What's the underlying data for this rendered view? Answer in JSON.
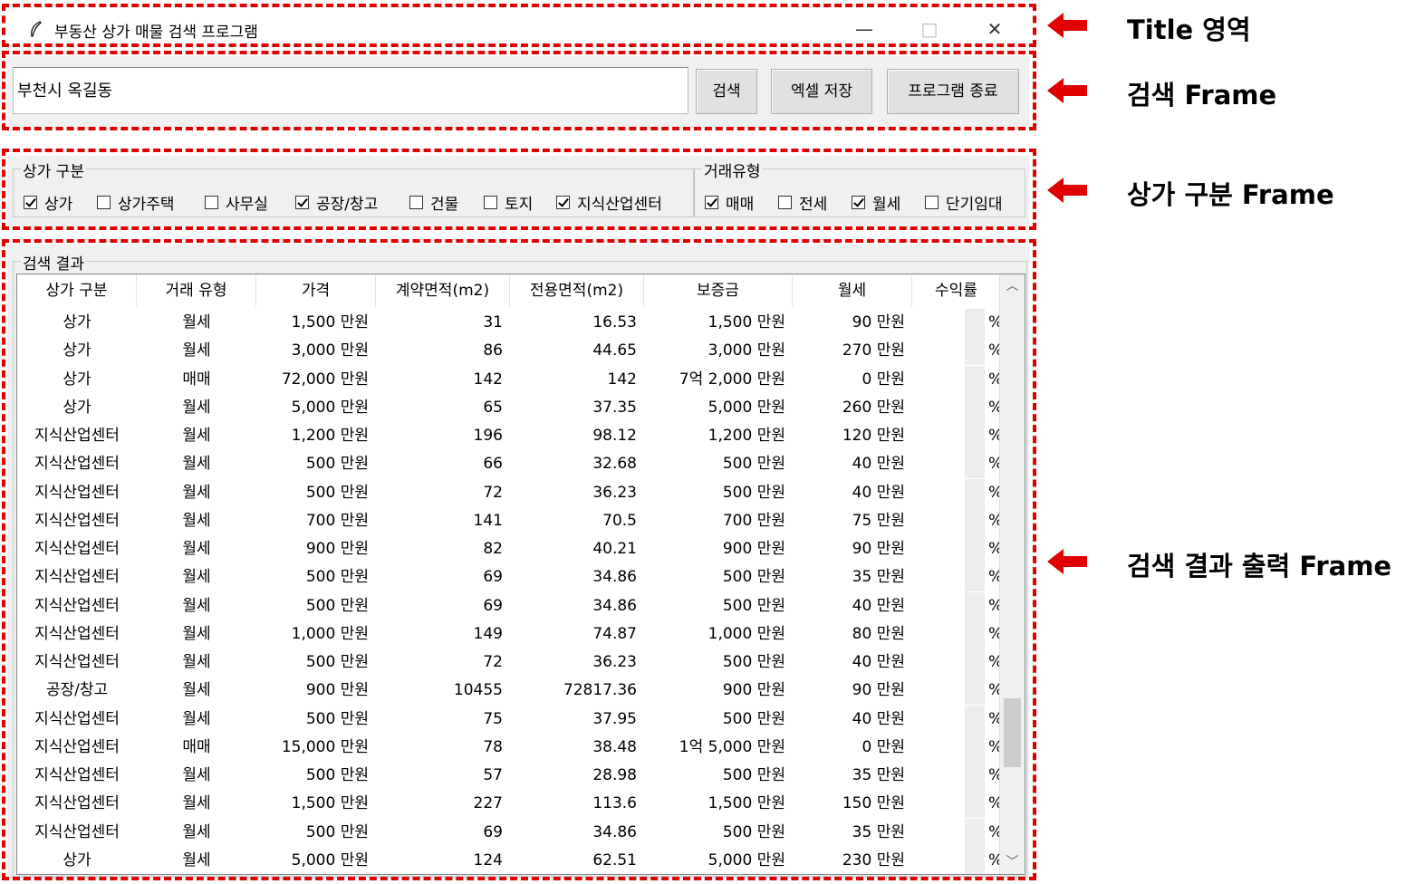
{
  "window": {
    "title": "부동산 상가 매물 검색 프로그램",
    "minimize": "—",
    "maximize": "□",
    "close": "✕"
  },
  "search": {
    "value": "부천시 옥길동",
    "search_button": "검색",
    "excel_button": "엑셀 저장",
    "exit_button": "프로그램 종료"
  },
  "store_type": {
    "label": "상가 구분",
    "options": [
      {
        "label": "상가",
        "checked": true
      },
      {
        "label": "상가주택",
        "checked": false
      },
      {
        "label": "사무실",
        "checked": false
      },
      {
        "label": "공장/창고",
        "checked": true
      },
      {
        "label": "건물",
        "checked": false
      },
      {
        "label": "토지",
        "checked": false
      },
      {
        "label": "지식산업센터",
        "checked": true
      }
    ]
  },
  "deal_type": {
    "label": "거래유형",
    "options": [
      {
        "label": "매매",
        "checked": true
      },
      {
        "label": "전세",
        "checked": false
      },
      {
        "label": "월세",
        "checked": true
      },
      {
        "label": "단기임대",
        "checked": false
      }
    ]
  },
  "results": {
    "label": "검색 결과",
    "columns": [
      "상가 구분",
      "거래 유형",
      "가격",
      "계약면적(m2)",
      "전용면적(m2)",
      "보증금",
      "월세",
      "수익률"
    ],
    "rows": [
      [
        "상가",
        "월세",
        "1,500 만원",
        "31",
        "16.53",
        "1,500 만원",
        "90 만원",
        "%"
      ],
      [
        "상가",
        "월세",
        "3,000 만원",
        "86",
        "44.65",
        "3,000 만원",
        "270 만원",
        "%"
      ],
      [
        "상가",
        "매매",
        "72,000 만원",
        "142",
        "142",
        "7억 2,000 만원",
        "0 만원",
        "%"
      ],
      [
        "상가",
        "월세",
        "5,000 만원",
        "65",
        "37.35",
        "5,000 만원",
        "260 만원",
        "%"
      ],
      [
        "지식산업센터",
        "월세",
        "1,200 만원",
        "196",
        "98.12",
        "1,200 만원",
        "120 만원",
        "%"
      ],
      [
        "지식산업센터",
        "월세",
        "500 만원",
        "66",
        "32.68",
        "500 만원",
        "40 만원",
        "%"
      ],
      [
        "지식산업센터",
        "월세",
        "500 만원",
        "72",
        "36.23",
        "500 만원",
        "40 만원",
        "%"
      ],
      [
        "지식산업센터",
        "월세",
        "700 만원",
        "141",
        "70.5",
        "700 만원",
        "75 만원",
        "%"
      ],
      [
        "지식산업센터",
        "월세",
        "900 만원",
        "82",
        "40.21",
        "900 만원",
        "90 만원",
        "%"
      ],
      [
        "지식산업센터",
        "월세",
        "500 만원",
        "69",
        "34.86",
        "500 만원",
        "35 만원",
        "%"
      ],
      [
        "지식산업센터",
        "월세",
        "500 만원",
        "69",
        "34.86",
        "500 만원",
        "40 만원",
        "%"
      ],
      [
        "지식산업센터",
        "월세",
        "1,000 만원",
        "149",
        "74.87",
        "1,000 만원",
        "80 만원",
        "%"
      ],
      [
        "지식산업센터",
        "월세",
        "500 만원",
        "72",
        "36.23",
        "500 만원",
        "40 만원",
        "%"
      ],
      [
        "공장/창고",
        "월세",
        "900 만원",
        "10455",
        "72817.36",
        "900 만원",
        "90 만원",
        "%"
      ],
      [
        "지식산업센터",
        "월세",
        "500 만원",
        "75",
        "37.95",
        "500 만원",
        "40 만원",
        "%"
      ],
      [
        "지식산업센터",
        "매매",
        "15,000 만원",
        "78",
        "38.48",
        "1억 5,000 만원",
        "0 만원",
        "%"
      ],
      [
        "지식산업센터",
        "월세",
        "500 만원",
        "57",
        "28.98",
        "500 만원",
        "35 만원",
        "%"
      ],
      [
        "지식산업센터",
        "월세",
        "1,500 만원",
        "227",
        "113.6",
        "1,500 만원",
        "150 만원",
        "%"
      ],
      [
        "지식산업센터",
        "월세",
        "500 만원",
        "69",
        "34.86",
        "500 만원",
        "35 만원",
        "%"
      ],
      [
        "상가",
        "월세",
        "5,000 만원",
        "124",
        "62.51",
        "5,000 만원",
        "230 만원",
        "%"
      ]
    ]
  },
  "annotations": [
    {
      "label": "Title 영역"
    },
    {
      "label": "검색 Frame"
    },
    {
      "label": "상가 구분 Frame"
    },
    {
      "label": "검색 결과 출력 Frame"
    }
  ],
  "colors": {
    "annotation_red": "#e00000",
    "panel_bg": "#f0f0f0"
  }
}
